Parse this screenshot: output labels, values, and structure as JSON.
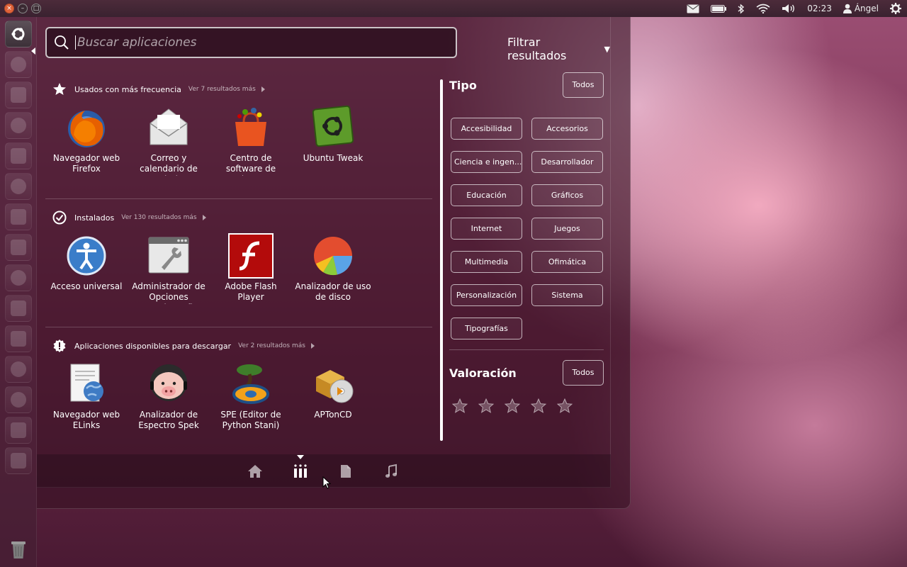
{
  "top_panel": {
    "time": "02:23",
    "user": "Ángel"
  },
  "launcher": {
    "items": [
      "dash-home",
      "firefox",
      "mail",
      "webcam",
      "gimp",
      "skype",
      "document",
      "settings",
      "network",
      "terminal-like",
      "display",
      "downloads",
      "tools",
      "info",
      "terminal",
      "panel"
    ],
    "trash": "trash-icon"
  },
  "dash": {
    "search": {
      "placeholder": "Buscar aplicaciones"
    },
    "filter_toggle": "Filtrar resultados",
    "categories": [
      {
        "title": "Usados con más frecuencia",
        "more": "Ver 7 resultados más",
        "apps": [
          {
            "label": "Navegador web Firefox",
            "icon": "firefox-icon"
          },
          {
            "label": "Correo y calendario de Evolution",
            "icon": "mail-icon"
          },
          {
            "label": "Centro de software de Ubuntu",
            "icon": "software-center-icon"
          },
          {
            "label": "Ubuntu Tweak",
            "icon": "ubuntu-tweak-icon"
          }
        ]
      },
      {
        "title": "Instalados",
        "more": "Ver 130 resultados más",
        "apps": [
          {
            "label": "Acceso universal",
            "icon": "accessibility-icon"
          },
          {
            "label": "Administrador de Opciones CompizConfig",
            "icon": "compiz-icon"
          },
          {
            "label": "Adobe Flash Player",
            "icon": "flash-icon"
          },
          {
            "label": "Analizador de uso de disco",
            "icon": "disk-usage-icon"
          }
        ]
      },
      {
        "title": "Aplicaciones disponibles para descargar",
        "more": "Ver 2 resultados más",
        "apps": [
          {
            "label": "Navegador web ELinks",
            "icon": "elinks-icon"
          },
          {
            "label": "Analizador de Espectro Spek",
            "icon": "spek-icon"
          },
          {
            "label": "SPE (Editor de Python Stani)",
            "icon": "spe-icon"
          },
          {
            "label": "APTonCD",
            "icon": "aptoncd-icon"
          }
        ]
      }
    ],
    "filters": {
      "type_title": "Tipo",
      "all_label": "Todos",
      "types": [
        "Accesibilidad",
        "Accesorios",
        "Ciencia e ingen...",
        "Desarrollador",
        "Educación",
        "Gráficos",
        "Internet",
        "Juegos",
        "Multimedia",
        "Ofimática",
        "Personalización",
        "Sistema",
        "Tipografías"
      ],
      "rating_title": "Valoración",
      "rating_all_label": "Todos",
      "rating_stars": 5
    },
    "lenses": [
      "home-lens-icon",
      "applications-lens-icon",
      "files-lens-icon",
      "music-lens-icon"
    ],
    "active_lens": "applications-lens-icon"
  },
  "colors": {
    "accent": "#dd4814",
    "panel_bg": "#3a2230",
    "dash_tint": "#371224"
  }
}
